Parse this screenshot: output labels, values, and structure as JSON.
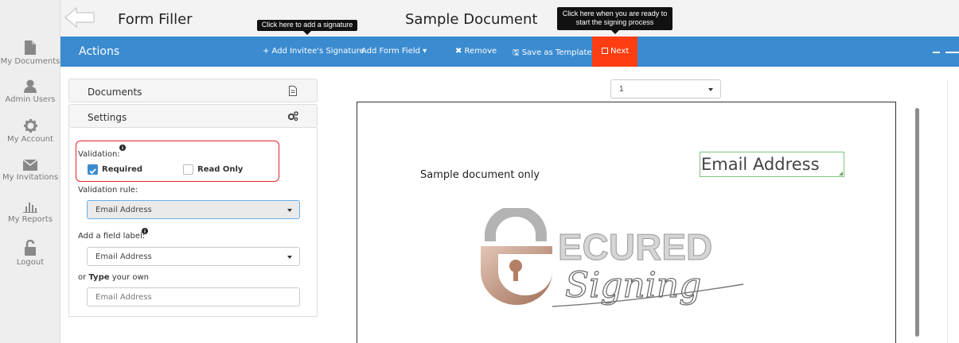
{
  "sidebar": {
    "items": [
      {
        "label": "My Documents",
        "icon": "document-icon"
      },
      {
        "label": "Admin Users",
        "icon": "user-icon"
      },
      {
        "label": "My Account",
        "icon": "gear-icon"
      },
      {
        "label": "My Invitations",
        "icon": "envelope-icon"
      },
      {
        "label": "My Reports",
        "icon": "bar-chart-icon"
      },
      {
        "label": "Logout",
        "icon": "unlock-icon"
      }
    ]
  },
  "header": {
    "app_title": "Form Filler",
    "doc_title": "Sample Document",
    "tooltip_signature": "Click here to add a signature",
    "tooltip_next": "Click here when you are ready to start the signing process"
  },
  "actionbar": {
    "title": "Actions",
    "add_invitee": "+ Add Invitee's Signature",
    "add_form_field": "Add Form Field ▾",
    "remove": "✖ Remove",
    "save_template": "🖫 Save as Template",
    "next": "Next"
  },
  "panel": {
    "documents_title": "Documents",
    "settings_title": "Settings",
    "validation_label": "Validation:",
    "required_label": "Required",
    "required_checked": true,
    "readonly_label": "Read Only",
    "readonly_checked": false,
    "validation_rule_label": "Validation rule:",
    "validation_rule_value": "Email Address",
    "field_label_label": "Add a field label:",
    "field_label_value": "Email Address",
    "or_type_prefix": "or ",
    "or_type_bold": "Type",
    "or_type_suffix": " your own",
    "custom_label_placeholder": "Email Address"
  },
  "viewer": {
    "page_select": "1",
    "sample_text": "Sample document only",
    "email_field_text": "Email Address",
    "logo_text_1": "ECURED",
    "logo_text_2": "Signing"
  },
  "colors": {
    "accent": "#3b8bd0",
    "next": "#ff3d12",
    "highlight": "#e3242b"
  }
}
